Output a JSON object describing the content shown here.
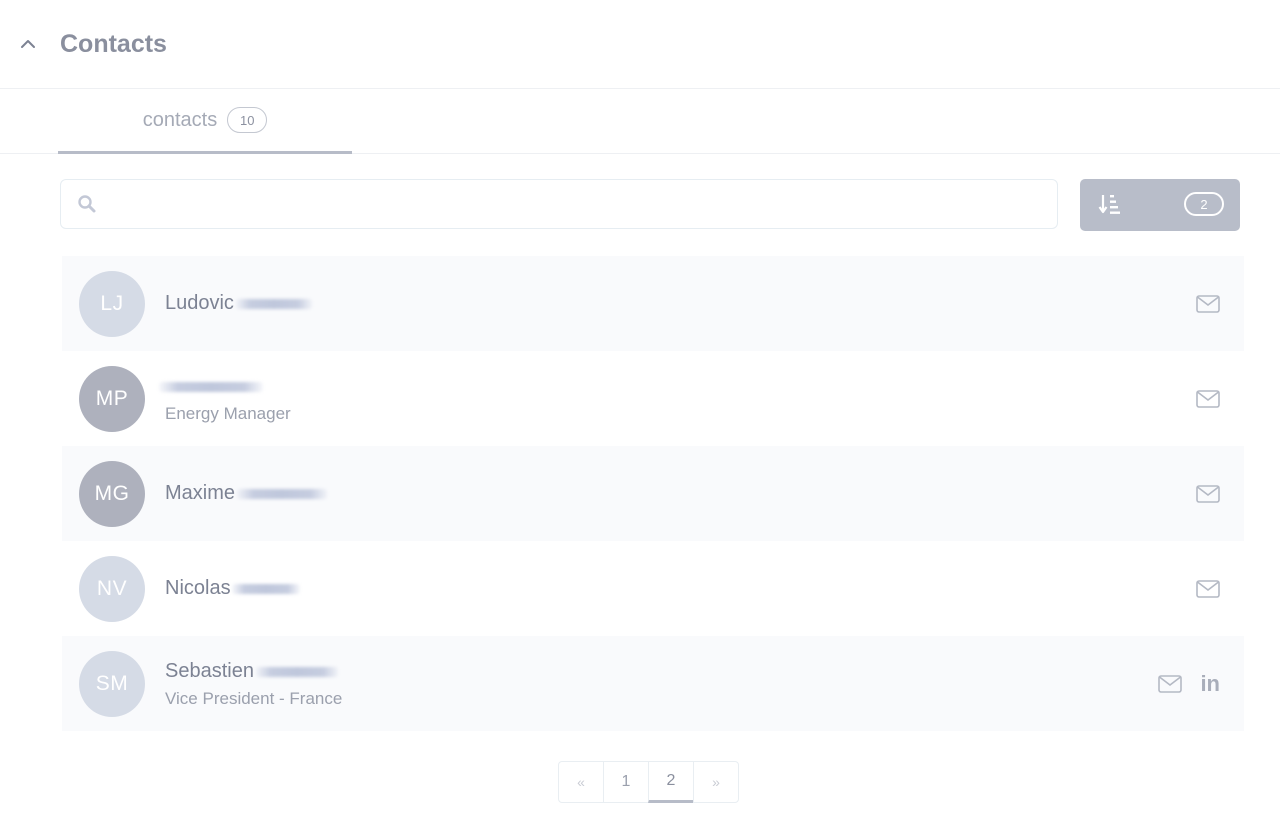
{
  "section": {
    "title": "Contacts"
  },
  "tabs": [
    {
      "label": "contacts",
      "count": "10"
    }
  ],
  "search": {
    "value": "",
    "placeholder": ""
  },
  "sort": {
    "count": "2"
  },
  "contacts": [
    {
      "initials": "LJ",
      "name": "Ludovic",
      "role": "",
      "avatar_style": "light",
      "actions": [
        "email"
      ]
    },
    {
      "initials": "MP",
      "name": "",
      "role": "Energy Manager",
      "avatar_style": "dark",
      "actions": [
        "email"
      ]
    },
    {
      "initials": "MG",
      "name": "Maxime",
      "role": "",
      "avatar_style": "dark",
      "actions": [
        "email"
      ]
    },
    {
      "initials": "NV",
      "name": "Nicolas",
      "role": "",
      "avatar_style": "light",
      "actions": [
        "email"
      ]
    },
    {
      "initials": "SM",
      "name": "Sebastien",
      "role": "Vice President - France",
      "avatar_style": "light",
      "actions": [
        "email",
        "linkedin"
      ]
    }
  ],
  "pagination": {
    "prev": "«",
    "pages": [
      "1",
      "2"
    ],
    "current": "2",
    "next": "»"
  },
  "icons": {
    "collapse": "chevron-up-icon",
    "search": "search-icon",
    "sort": "sort-descending-icon",
    "email": "envelope-icon",
    "linkedin": "linkedin-icon"
  },
  "colors": {
    "sort_button": "#b8bdc9",
    "avatar_light": "#d5dbe6",
    "avatar_dark": "#aeb1bd",
    "row_alt": "#f9fafc"
  }
}
